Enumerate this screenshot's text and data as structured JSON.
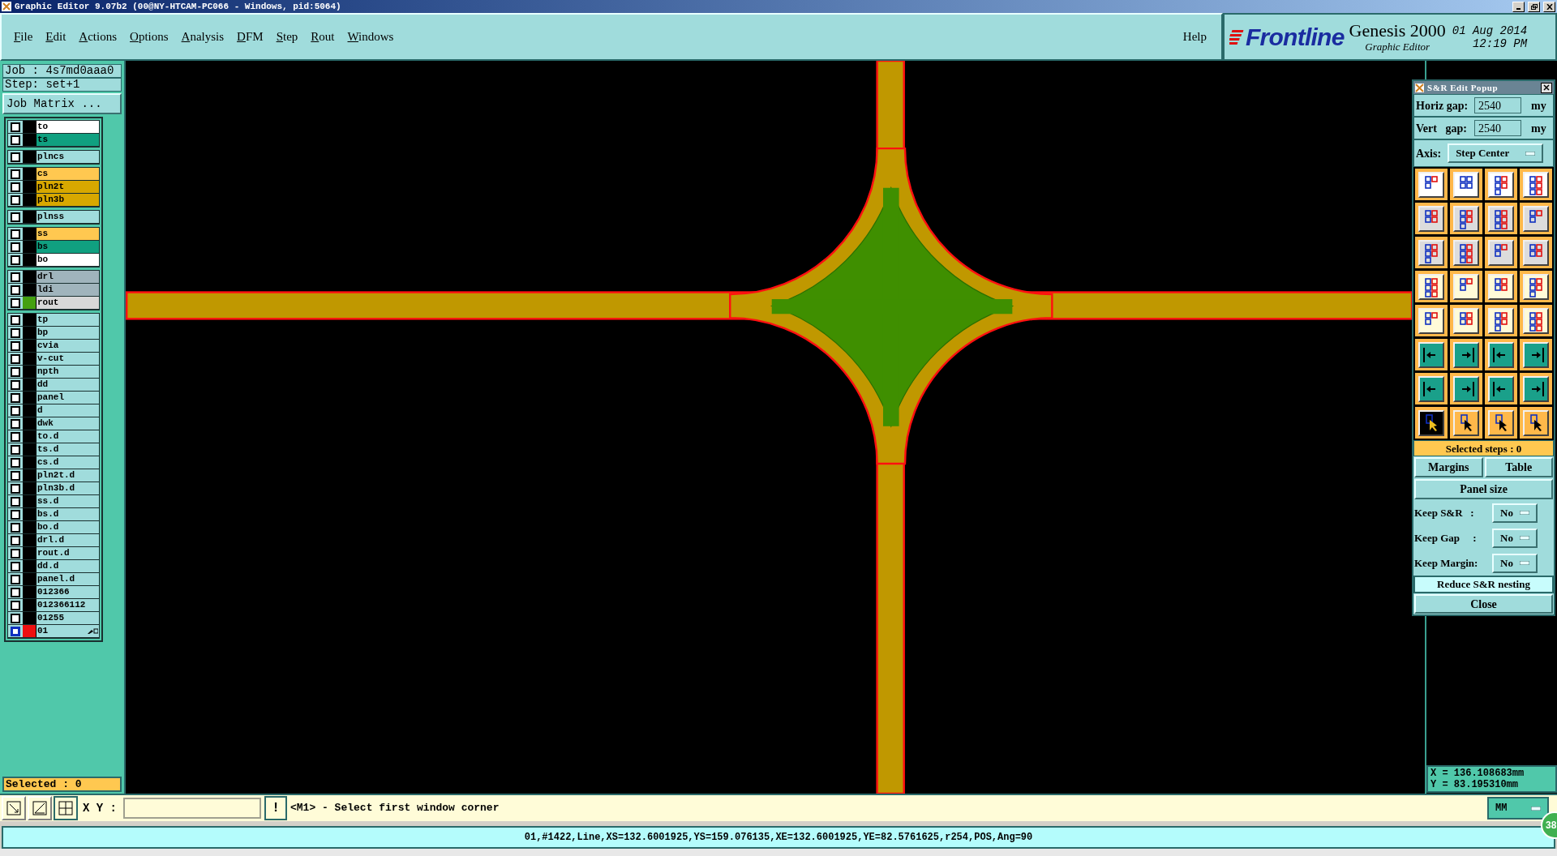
{
  "window": {
    "title": "Graphic Editor 9.07b2 (00@NY-HTCAM-PC066 - Windows, pid:5064)"
  },
  "menu": [
    "File",
    "Edit",
    "Actions",
    "Options",
    "Analysis",
    "DFM",
    "Step",
    "Rout",
    "Windows"
  ],
  "help": "Help",
  "brand": {
    "logo": "Frontline",
    "product": "Genesis 2000",
    "subtitle": "Graphic Editor",
    "date": "01 Aug 2014",
    "time": "12:19 PM"
  },
  "job": {
    "job": "Job : 4s7md0aaa0",
    "step": "Step: set+1",
    "matrix_button": "Job Matrix ..."
  },
  "layer_groups": [
    {
      "layers": [
        {
          "name": "to",
          "color": "#ffffff",
          "selected": false
        },
        {
          "name": "ts",
          "color": "#10a080",
          "selected": false
        }
      ]
    },
    {
      "layers": [
        {
          "name": "plncs",
          "color": "#a0dcdc",
          "selected": false
        }
      ]
    },
    {
      "layers": [
        {
          "name": "cs",
          "color": "#ffc850",
          "selected": false
        },
        {
          "name": "pln2t",
          "color": "#d8a800",
          "selected": false
        },
        {
          "name": "pln3b",
          "color": "#d8a800",
          "selected": false
        }
      ]
    },
    {
      "layers": [
        {
          "name": "plnss",
          "color": "#a0dcdc",
          "selected": false
        }
      ]
    },
    {
      "layers": [
        {
          "name": "ss",
          "color": "#ffc850",
          "selected": false
        },
        {
          "name": "bs",
          "color": "#10a080",
          "selected": false
        },
        {
          "name": "bo",
          "color": "#ffffff",
          "selected": false
        }
      ]
    },
    {
      "layers": [
        {
          "name": "drl",
          "color": "#a0b4bc",
          "selected": false
        },
        {
          "name": "ldi",
          "color": "#a0b4bc",
          "selected": false
        },
        {
          "name": "rout",
          "color": "#d8d8d8",
          "selected": false,
          "swatch": {
            "color": "#44a010"
          }
        }
      ]
    },
    {
      "layers": [
        {
          "name": "tp",
          "color": "#a0dcdc",
          "selected": false
        },
        {
          "name": "bp",
          "color": "#a0dcdc",
          "selected": false
        },
        {
          "name": "cvia",
          "color": "#a0dcdc",
          "selected": false
        },
        {
          "name": "v-cut",
          "color": "#a0dcdc",
          "selected": false
        },
        {
          "name": "npth",
          "color": "#a0dcdc",
          "selected": false
        },
        {
          "name": "dd",
          "color": "#a0dcdc",
          "selected": false
        },
        {
          "name": "panel",
          "color": "#a0dcdc",
          "selected": false
        },
        {
          "name": "d",
          "color": "#a0dcdc",
          "selected": false
        },
        {
          "name": "dwk",
          "color": "#a0dcdc",
          "selected": false
        },
        {
          "name": "to.d",
          "color": "#a0dcdc",
          "selected": false
        },
        {
          "name": "ts.d",
          "color": "#a0dcdc",
          "selected": false
        },
        {
          "name": "cs.d",
          "color": "#a0dcdc",
          "selected": false
        },
        {
          "name": "pln2t.d",
          "color": "#a0dcdc",
          "selected": false
        },
        {
          "name": "pln3b.d",
          "color": "#a0dcdc",
          "selected": false
        },
        {
          "name": "ss.d",
          "color": "#a0dcdc",
          "selected": false
        },
        {
          "name": "bs.d",
          "color": "#a0dcdc",
          "selected": false
        },
        {
          "name": "bo.d",
          "color": "#a0dcdc",
          "selected": false
        },
        {
          "name": "drl.d",
          "color": "#a0dcdc",
          "selected": false
        },
        {
          "name": "rout.d",
          "color": "#a0dcdc",
          "selected": false
        },
        {
          "name": "dd.d",
          "color": "#a0dcdc",
          "selected": false
        },
        {
          "name": "panel.d",
          "color": "#a0dcdc",
          "selected": false
        },
        {
          "name": "012366",
          "color": "#a0dcdc",
          "selected": false
        },
        {
          "name": "012366112",
          "color": "#a0dcdc",
          "selected": false
        },
        {
          "name": "01255",
          "color": "#a0dcdc",
          "selected": false
        },
        {
          "name": "01",
          "color": "#a0dcdc",
          "selected": true,
          "swatch": {
            "color": "#ee1010"
          }
        }
      ]
    }
  ],
  "selected_count": "Selected : 0",
  "popup": {
    "title": "S&R Edit Popup",
    "horiz_label": "Horiz gap:",
    "horiz_value": "2540",
    "horiz_unit": "my",
    "vert_label": "Vert   gap:",
    "vert_value": "2540",
    "vert_unit": "my",
    "axis_label": "Axis:",
    "axis_value": "Step Center",
    "pick_modes": [
      {
        "selected": true
      },
      {
        "selected": false
      },
      {
        "selected": false
      },
      {
        "selected": false
      }
    ],
    "selected_steps": "Selected steps : 0",
    "margins": "Margins",
    "table": "Table",
    "panel_size": "Panel size",
    "options": [
      {
        "label": "Keep S&R   :",
        "value": "No"
      },
      {
        "label": "Keep Gap     :",
        "value": "No"
      },
      {
        "label": "Keep Margin:",
        "value": "No"
      }
    ],
    "reduce": "Reduce S&R nesting",
    "close": "Close"
  },
  "coordinates": {
    "x": "X = 136.108683mm",
    "y": "Y = 83.195310mm"
  },
  "command": {
    "xy_label": "X Y :",
    "bang": "!",
    "message": "<M1> - Select first window corner",
    "units": "MM"
  },
  "status_bar": "01,#1422,Line,XS=132.6001925,YS=159.076135,XE=132.6001925,YE=82.5761625,r254,POS,Ang=90",
  "badge": "38"
}
